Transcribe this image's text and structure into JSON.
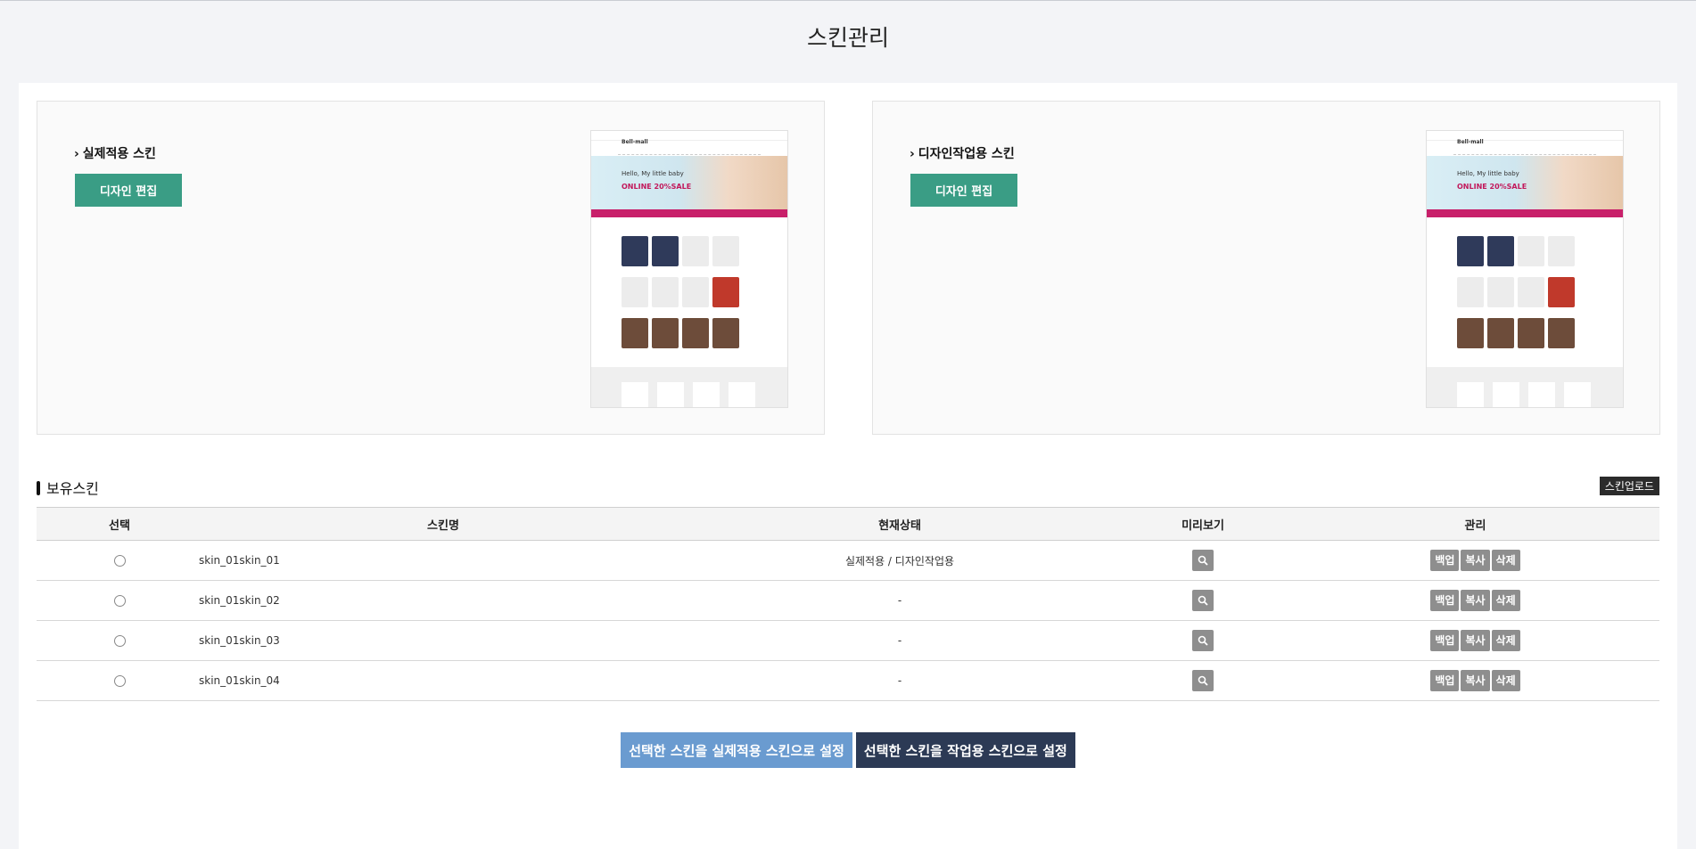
{
  "page": {
    "title": "스킨관리"
  },
  "previews": [
    {
      "label": "실제적용 스킨",
      "button": "디자인 편집"
    },
    {
      "label": "디자인작업용 스킨",
      "button": "디자인 편집"
    }
  ],
  "thumbnail": {
    "logo": "Bell-mall",
    "hero_text": "Hello, My little baby",
    "hero_sale": "ONLINE 20%SALE"
  },
  "section": {
    "title": "보유스킨",
    "upload_label": "스킨업로드"
  },
  "table": {
    "headers": [
      "선택",
      "스킨명",
      "현재상태",
      "미리보기",
      "관리"
    ],
    "rows": [
      {
        "name": "skin_01skin_01",
        "status": "실제적용 / 디자인작업용"
      },
      {
        "name": "skin_01skin_02",
        "status": "-"
      },
      {
        "name": "skin_01skin_03",
        "status": "-"
      },
      {
        "name": "skin_01skin_04",
        "status": "-"
      }
    ],
    "actions": {
      "backup": "백업",
      "copy": "복사",
      "delete": "삭제"
    }
  },
  "bottom": {
    "set_live": "선택한 스킨을 실제적용 스킨으로 설정",
    "set_work": "선택한 스킨을 작업용 스킨으로 설정"
  },
  "colors": {
    "accent_green": "#3a9d85",
    "live_blue": "#6a9bd0",
    "work_navy": "#2c3a55",
    "action_gray": "#8e8e8e"
  }
}
